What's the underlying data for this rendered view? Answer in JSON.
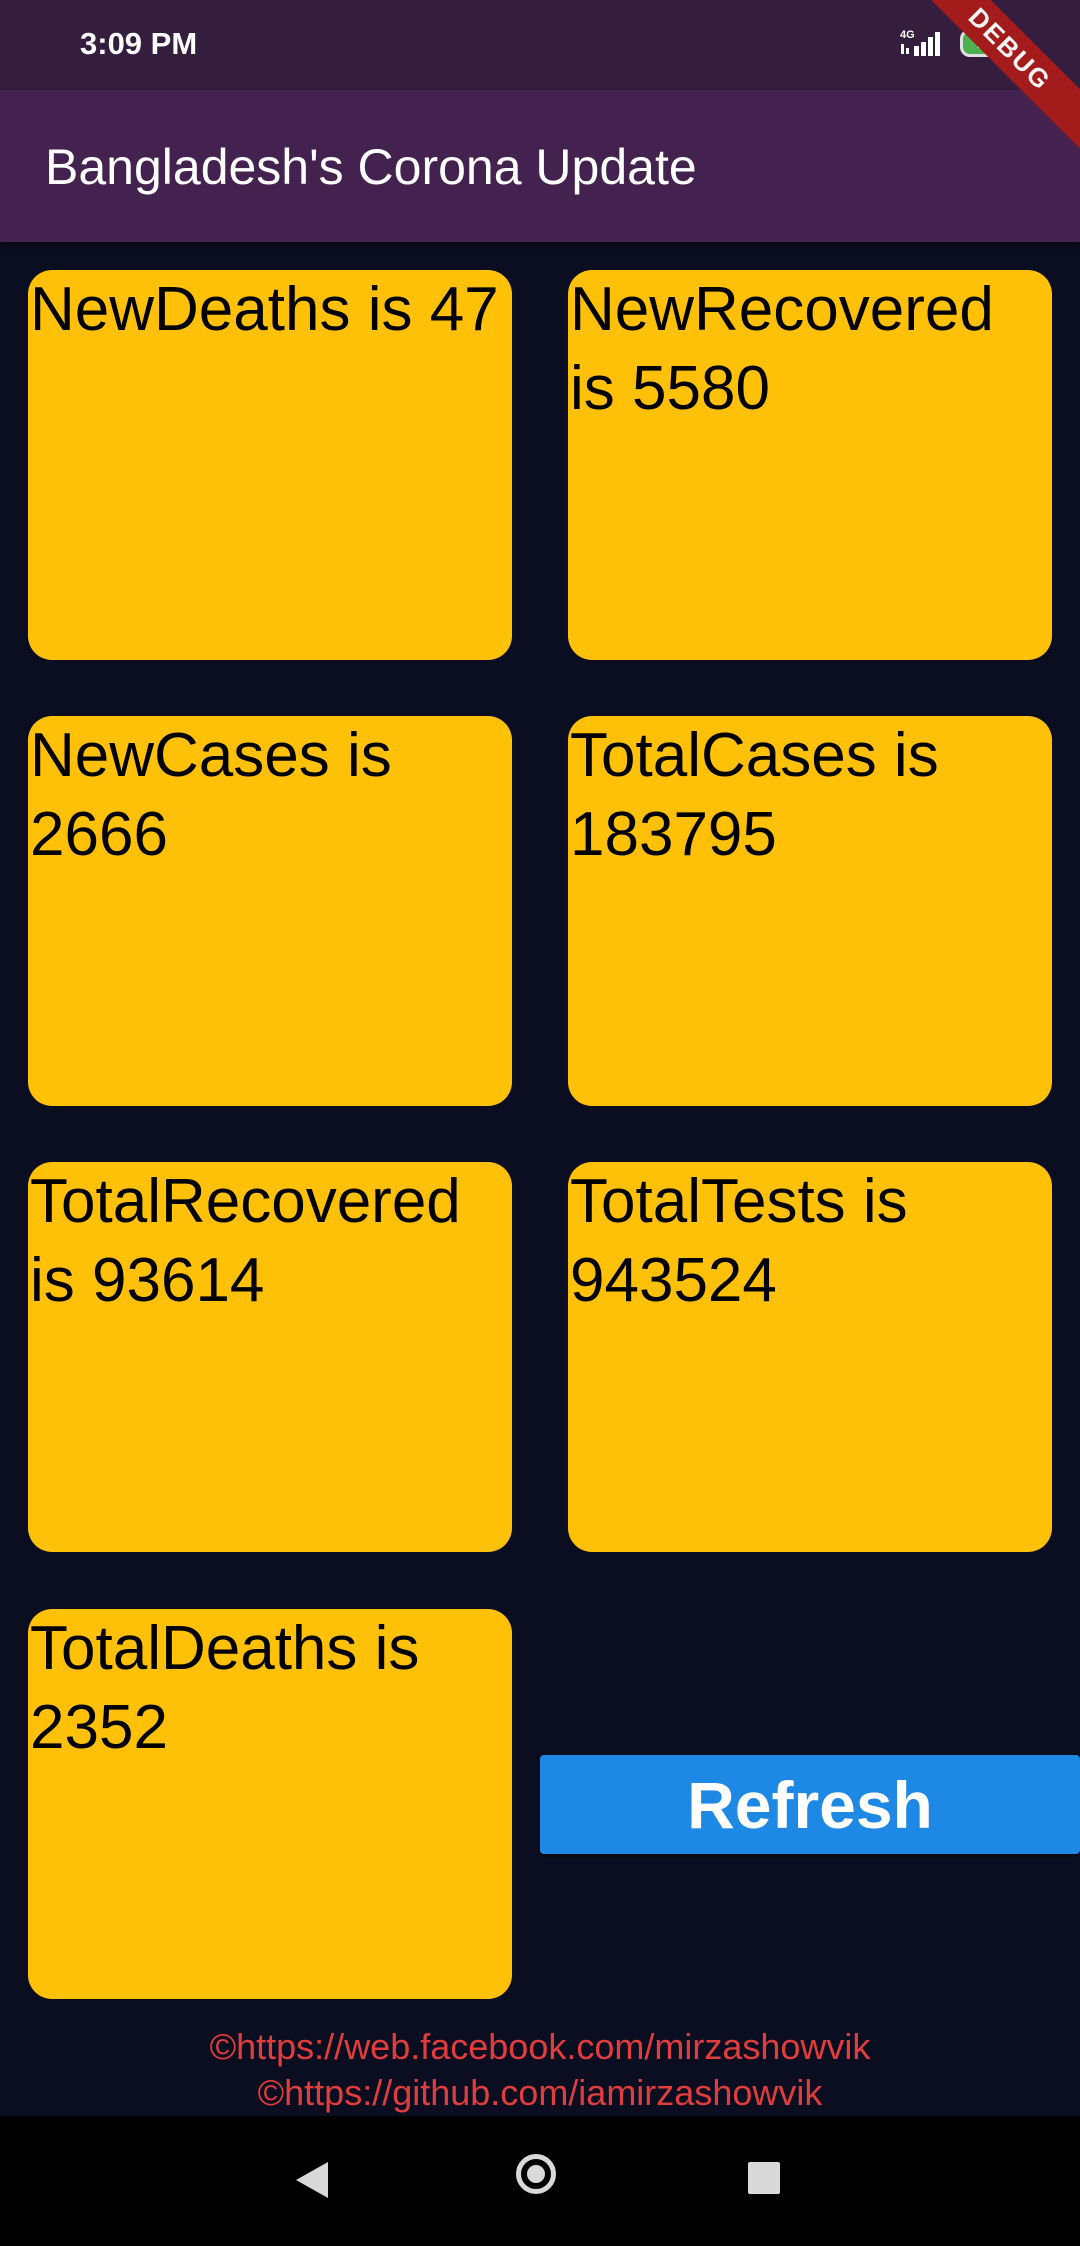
{
  "status_bar": {
    "time": "3:09 PM",
    "network": "4G",
    "battery": "100"
  },
  "app_bar": {
    "title": "Bangladesh's Corona Update",
    "debug_banner": "DEBUG"
  },
  "cards": [
    {
      "label": "NewDeaths is 47"
    },
    {
      "label": "NewRecovered is 5580"
    },
    {
      "label": "NewCases is 2666"
    },
    {
      "label": "TotalCases is 183795"
    },
    {
      "label": "TotalRecovered is 93614"
    },
    {
      "label": "TotalTests is 943524"
    },
    {
      "label": "TotalDeaths is 2352"
    }
  ],
  "refresh_button": {
    "label": "Refresh",
    "color": "#1e88e5"
  },
  "footer": {
    "facebook": "©https://web.facebook.com/mirzashowvik",
    "github": "©https://github.com/iamirzashowvik"
  },
  "colors": {
    "card": "#ffc107",
    "background": "#0b0e20",
    "app_bar": "#44224f",
    "footer_text": "#e23d3d"
  }
}
